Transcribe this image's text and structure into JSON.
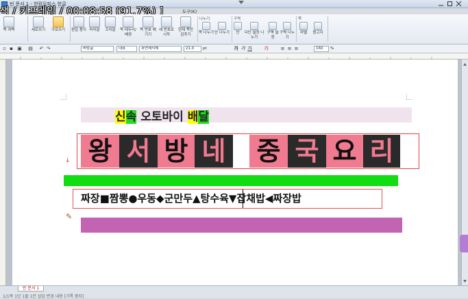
{
  "window": {
    "title": "빈 문서 1 - 한컴오피스 한글"
  },
  "overlay": {
    "text": "색 / 키프레임 / 00:08:58 (91.7%) ]"
  },
  "menu": {
    "tool_tab": "도구(K)"
  },
  "ribbon": {
    "groups": [
      {
        "label": "나누기"
      },
      {
        "label": "구역"
      },
      {
        "label": "쪽"
      }
    ],
    "buttons": [
      {
        "label": "쪽 여백"
      },
      {
        "label": "세로쓰기"
      },
      {
        "label": "가로쓰기"
      },
      {
        "label": "편집 용지"
      },
      {
        "label": "머리말"
      },
      {
        "label": "꼬리말"
      },
      {
        "label": "쪽 테두리/배경"
      },
      {
        "label": "쪽 번호 매기기"
      },
      {
        "label": "새 번호로 시작"
      },
      {
        "label": "현재 쪽만 감추기"
      },
      {
        "label": "쪽 나누기"
      },
      {
        "label": "단 나누기"
      },
      {
        "label": "단"
      },
      {
        "label": "다단 설정 나누기"
      },
      {
        "label": "구역 설정"
      },
      {
        "label": "구역 나누기"
      },
      {
        "label": "라벨"
      },
      {
        "label": "원고지"
      }
    ]
  },
  "toolbar": {
    "style": "바탕글",
    "lang": "대표",
    "font": "휴먼매직체",
    "size": "21.0",
    "size_unit": "pt",
    "bold": "가",
    "italic": "가",
    "underline": "가",
    "zoom": "160",
    "zoom_unit": "%"
  },
  "document": {
    "subtitle_parts": [
      {
        "text": "신",
        "hl": "yellow"
      },
      {
        "text": "속",
        "hl": "green"
      },
      {
        "text": " 오토바이 ",
        "hl": "none"
      },
      {
        "text": "배",
        "hl": "yellow"
      },
      {
        "text": "달",
        "hl": "green"
      }
    ],
    "title_chars": [
      "왕",
      "서",
      "방",
      "네",
      "중",
      "국",
      "요",
      "리"
    ],
    "menu_line": "짜장■짬뽕●우동◆군만두▲탕수육▼잡채밥◀짜장밥"
  },
  "status": {
    "doc_tab": "빈 문서 1",
    "items": "1/1쪽   1단   1줄   1칸   삽입   변경 내용 [기록 중지]"
  },
  "colors": {
    "pink": "#f07a90",
    "dark": "#2a2a2a",
    "green_bar": "#11dd11",
    "purple_bar": "#c264b2"
  }
}
